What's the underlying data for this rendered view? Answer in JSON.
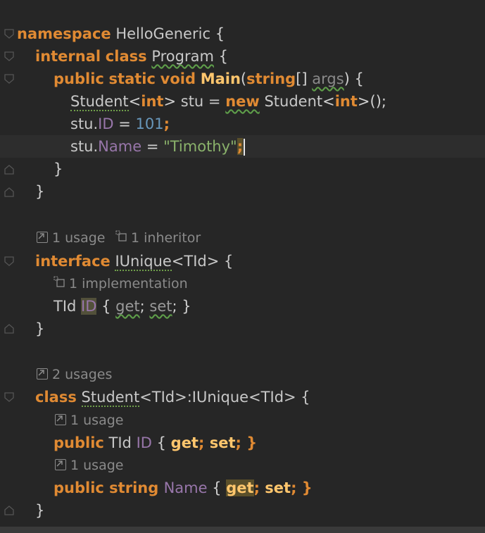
{
  "code": {
    "l1_namespace": "namespace",
    "l1_name": "HelloGeneric",
    "l1_brace": "{",
    "l2_internal": "internal",
    "l2_class": "class",
    "l2_name": "Program",
    "l2_brace": "{",
    "l3_public": "public",
    "l3_static": "static",
    "l3_void": "void",
    "l3_main": "Main",
    "l3_paren_open": "(",
    "l3_string": "string",
    "l3_arr": "[]",
    "l3_args": "args",
    "l3_close": ") {",
    "l4_student1": "Student",
    "l4_lt1": "<",
    "l4_int1": "int",
    "l4_gt1": ">",
    "l4_stu": " stu = ",
    "l4_new": "new",
    "l4_student2": " Student",
    "l4_lt2": "<",
    "l4_int2": "int",
    "l4_tail": ">();",
    "l5_stu": "stu.",
    "l5_id": "ID",
    "l5_eq": " = ",
    "l5_num": "101",
    "l5_semi": ";",
    "l6_stu": "stu.",
    "l6_name": "Name",
    "l6_eq": " = ",
    "l6_str": "\"Timothy\"",
    "l6_semi": ";",
    "l7_brace": "}",
    "l8_brace": "}",
    "l10_interface": "interface",
    "l10_name": "IUnique",
    "l10_generic": "<TId> {",
    "l11_type": "TId",
    "l11_id": "ID",
    "l11_brace_open": " { ",
    "l11_get": "get",
    "l11_semi1": "; ",
    "l11_set": "set",
    "l11_semi2": "; }",
    "l12_brace": "}",
    "l14_class": "class",
    "l14_name": "Student",
    "l14_rest": "<TId>:IUnique<TId> {",
    "l15_public": "public",
    "l15_type": " TId ",
    "l15_id": "ID",
    "l15_brace_open": " { ",
    "l15_get": "get",
    "l15_semi1": "; ",
    "l15_set": "set",
    "l15_semi2": "; }",
    "l16_public": "public",
    "l16_string": " string ",
    "l16_name": "Name",
    "l16_brace_open": " { ",
    "l16_get": "get",
    "l16_semi1": "; ",
    "l16_set": "set",
    "l16_semi2": "; }",
    "l17_brace": "}"
  },
  "hints": {
    "interface_usages": "1 usage",
    "interface_inheritors": "1 inheritor",
    "id_implementation": "1 implementation",
    "class_usages": "2 usages",
    "id_usage": "1 usage",
    "name_usage": "1 usage"
  },
  "icons": [
    "fold-arrow-icon",
    "fold-end-icon",
    "usage-arrow-icon",
    "inheritor-icon",
    "implementation-icon"
  ],
  "colors": {
    "background": "#262626",
    "keyword": "#e08a33",
    "function": "#ffc66d",
    "property": "#9876aa",
    "number": "#6897bb",
    "string": "#8ab26b"
  }
}
